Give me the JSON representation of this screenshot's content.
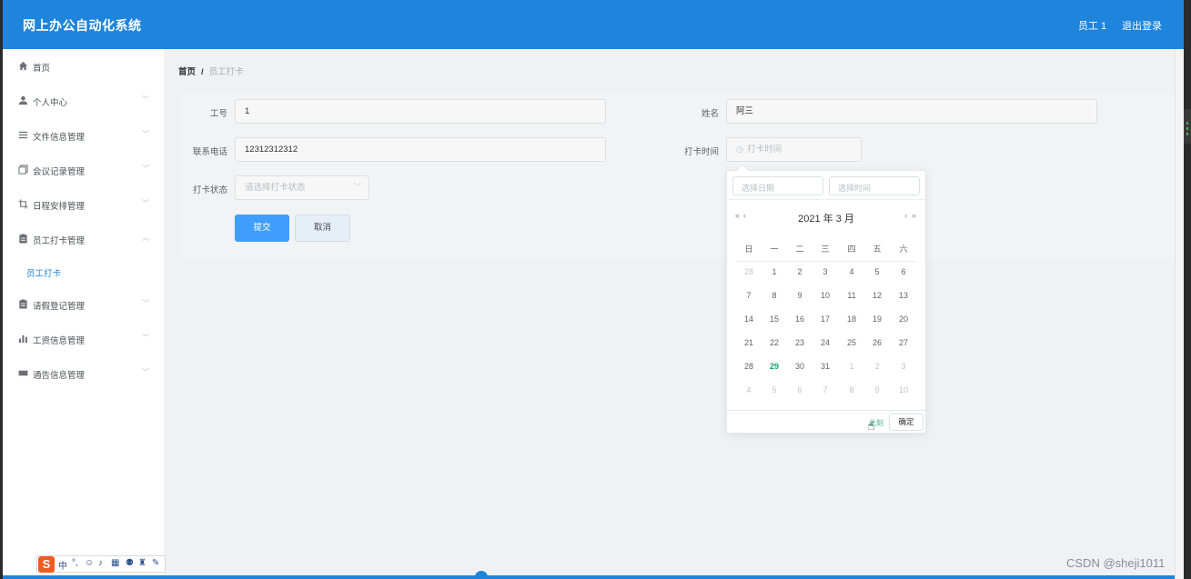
{
  "header": {
    "title": "网上办公自动化系统",
    "user": "员工 1",
    "logout": "退出登录"
  },
  "sidebar": {
    "items": [
      {
        "label": "首页",
        "icon": "home-icon"
      },
      {
        "label": "个人中心",
        "icon": "user-icon"
      },
      {
        "label": "文件信息管理",
        "icon": "list-icon"
      },
      {
        "label": "会议记录管理",
        "icon": "copy-icon"
      },
      {
        "label": "日程安排管理",
        "icon": "crop-icon"
      },
      {
        "label": "员工打卡管理",
        "icon": "clipboard-icon"
      },
      {
        "label": "请假登记管理",
        "icon": "clipboard-icon"
      },
      {
        "label": "工资信息管理",
        "icon": "bar-chart-icon"
      },
      {
        "label": "通告信息管理",
        "icon": "ticket-icon"
      }
    ],
    "sub_item": "员工打卡"
  },
  "breadcrumb": {
    "home": "首页",
    "separator": "/",
    "current": "员工打卡"
  },
  "form": {
    "emp_no": {
      "label": "工号",
      "value": "1"
    },
    "name": {
      "label": "姓名",
      "value": "阿三"
    },
    "phone": {
      "label": "联系电话",
      "value": "12312312312"
    },
    "clock_time": {
      "label": "打卡时间",
      "placeholder": "打卡时间"
    },
    "status": {
      "label": "打卡状态",
      "placeholder": "请选择打卡状态"
    },
    "submit": "提交",
    "cancel": "取消"
  },
  "picker": {
    "date_placeholder": "选择日期",
    "time_placeholder": "选择时间",
    "prev_year": "«",
    "prev_month": "‹",
    "next_month": "›",
    "next_year": "»",
    "title": "2021 年  3 月",
    "weekdays": [
      "日",
      "一",
      "二",
      "三",
      "四",
      "五",
      "六"
    ],
    "weeks": [
      [
        "28",
        "1",
        "2",
        "3",
        "4",
        "5",
        "6"
      ],
      [
        "7",
        "8",
        "9",
        "10",
        "11",
        "12",
        "13"
      ],
      [
        "14",
        "15",
        "16",
        "17",
        "18",
        "19",
        "20"
      ],
      [
        "21",
        "22",
        "23",
        "24",
        "25",
        "26",
        "27"
      ],
      [
        "28",
        "29",
        "30",
        "31",
        "1",
        "2",
        "3"
      ],
      [
        "4",
        "5",
        "6",
        "7",
        "8",
        "9",
        "10"
      ]
    ],
    "now": "此刻",
    "confirm": "确定"
  },
  "ime": {
    "logo": "S",
    "mode": "中"
  },
  "watermark": "CSDN @sheji1011",
  "colors": {
    "header": "#1e84dc",
    "primary": "#409eff",
    "today": "#13a36c"
  }
}
